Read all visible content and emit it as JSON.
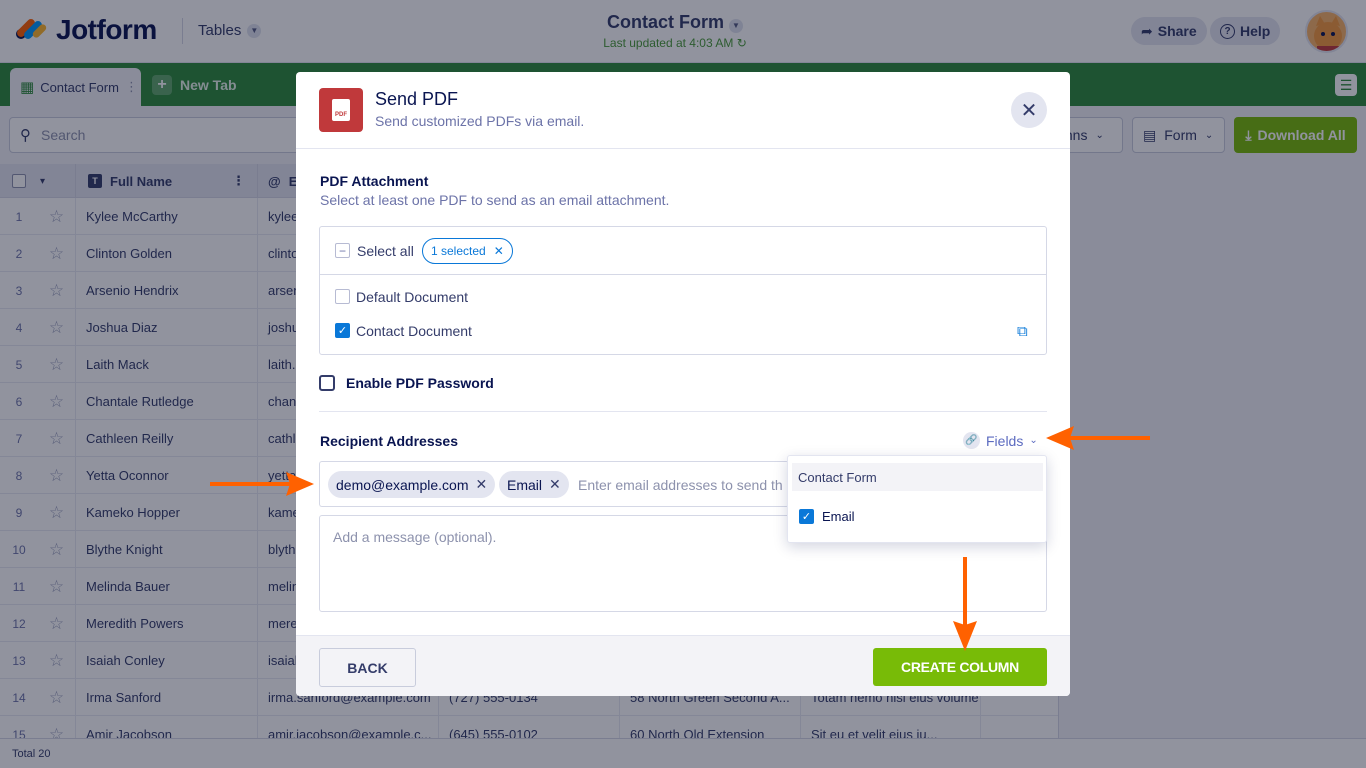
{
  "app": {
    "brand": "Jotform",
    "tables_menu": "Tables",
    "form_title": "Contact Form",
    "last_updated": "Last updated at 4:03 AM",
    "share": "Share",
    "help": "Help"
  },
  "tabs": {
    "active": "Contact Form",
    "new_tab": "New Tab"
  },
  "toolbar": {
    "search_placeholder": "Search",
    "columns": "mns",
    "form": "Form",
    "download_all": "Download All"
  },
  "table": {
    "columns": [
      "Full Name",
      "E"
    ],
    "rows": [
      {
        "n": "1",
        "name": "Kylee McCarthy",
        "email": "kylee",
        "phone": "",
        "address": "",
        "notes": ""
      },
      {
        "n": "2",
        "name": "Clinton Golden",
        "email": "clinto",
        "phone": "",
        "address": "",
        "notes": ""
      },
      {
        "n": "3",
        "name": "Arsenio Hendrix",
        "email": "arsen",
        "phone": "",
        "address": "",
        "notes": ""
      },
      {
        "n": "4",
        "name": "Joshua Diaz",
        "email": "joshu",
        "phone": "",
        "address": "",
        "notes": ""
      },
      {
        "n": "5",
        "name": "Laith Mack",
        "email": "laith.",
        "phone": "",
        "address": "",
        "notes": ""
      },
      {
        "n": "6",
        "name": "Chantale Rutledge",
        "email": "chant",
        "phone": "",
        "address": "",
        "notes": ""
      },
      {
        "n": "7",
        "name": "Cathleen Reilly",
        "email": "cathl",
        "phone": "",
        "address": "",
        "notes": ""
      },
      {
        "n": "8",
        "name": "Yetta Oconnor",
        "email": "yetta",
        "phone": "",
        "address": "",
        "notes": ""
      },
      {
        "n": "9",
        "name": "Kameko Hopper",
        "email": "kame",
        "phone": "",
        "address": "",
        "notes": ""
      },
      {
        "n": "10",
        "name": "Blythe Knight",
        "email": "blyth",
        "phone": "",
        "address": "",
        "notes": ""
      },
      {
        "n": "11",
        "name": "Melinda Bauer",
        "email": "melin",
        "phone": "",
        "address": "",
        "notes": ""
      },
      {
        "n": "12",
        "name": "Meredith Powers",
        "email": "mere",
        "phone": "",
        "address": "",
        "notes": ""
      },
      {
        "n": "13",
        "name": "Isaiah Conley",
        "email": "isaiah",
        "phone": "",
        "address": "",
        "notes": ""
      },
      {
        "n": "14",
        "name": "Irma Sanford",
        "email": "irma.sanford@example.com",
        "phone": "(727) 555-0134",
        "address": "58 North Green Second A...",
        "notes": "Totam nemo nisi eius volume"
      },
      {
        "n": "15",
        "name": "Amir Jacobson",
        "email": "amir.jacobson@example.c...",
        "phone": "(645) 555-0102",
        "address": "60 North Old Extension",
        "notes": "Sit eu et velit eius iu..."
      }
    ],
    "footer": "Total 20"
  },
  "modal": {
    "title": "Send PDF",
    "subtitle": "Send customized PDFs via email.",
    "attachment_title": "PDF Attachment",
    "attachment_sub": "Select at least one PDF to send as an email attachment.",
    "select_all": "Select all",
    "selected_pill": "1 selected",
    "documents": [
      {
        "label": "Default Document",
        "checked": false
      },
      {
        "label": "Contact Document",
        "checked": true
      }
    ],
    "enable_password": "Enable PDF Password",
    "recipients_title": "Recipient Addresses",
    "fields_link": "Fields",
    "chips": [
      "demo@example.com",
      "Email"
    ],
    "recipient_placeholder": "Enter email addresses to send th",
    "message_placeholder": "Add a message (optional).",
    "back": "BACK",
    "create": "CREATE COLUMN"
  },
  "dropdown": {
    "group": "Contact Form",
    "item": "Email",
    "item_checked": true
  },
  "colors": {
    "green_bar": "#2e8b3b",
    "accent_green": "#78bb07",
    "arrow": "#ff6100",
    "pdf_red": "#c0393b",
    "link_blue": "#0a78d8"
  }
}
